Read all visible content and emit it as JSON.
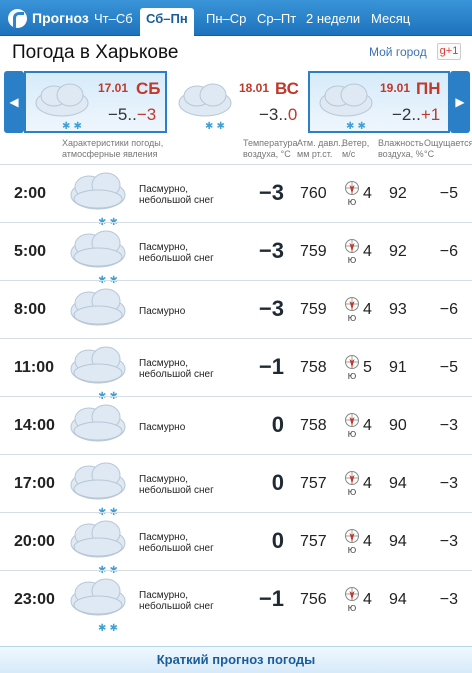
{
  "nav": {
    "brand": "Прогноз",
    "tabs": [
      "Чт–Сб",
      "Сб–Пн",
      "Пн–Ср",
      "Ср–Пт",
      "2 недели",
      "Месяц"
    ],
    "active_tab": "Сб–Пн"
  },
  "header": {
    "title": "Погода в Харькове",
    "my_city": "Мой город",
    "gplus": "g+1"
  },
  "days": [
    {
      "date": "17.01",
      "name": "СБ",
      "temp_min": "−5..",
      "temp_max": "−3",
      "selected": false
    },
    {
      "date": "18.01",
      "name": "ВС",
      "temp_min": "−3..",
      "temp_max": "0",
      "selected": true
    },
    {
      "date": "19.01",
      "name": "ПН",
      "temp_min": "−2..",
      "temp_max": "+1",
      "selected": false
    }
  ],
  "columns": {
    "condition": [
      "Характеристики погоды,",
      "атмосферные явления"
    ],
    "temperature": [
      "Температура",
      "воздуха, °С"
    ],
    "pressure": [
      "Атм. давл.,",
      "мм рт.ст."
    ],
    "wind": [
      "Ветер,",
      "м/с"
    ],
    "humidity": [
      "Влажность",
      "воздуха, %"
    ],
    "feels": [
      "Ощущается,",
      "°С"
    ]
  },
  "rows": [
    {
      "time": "2:00",
      "cond1": "Пасмурно,",
      "cond2": "небольшой снег",
      "snow": true,
      "temp": "−3",
      "pressure": "760",
      "wind_dir": "Ю",
      "wind": "4",
      "humidity": "92",
      "feels": "−5"
    },
    {
      "time": "5:00",
      "cond1": "Пасмурно,",
      "cond2": "небольшой снег",
      "snow": true,
      "temp": "−3",
      "pressure": "759",
      "wind_dir": "Ю",
      "wind": "4",
      "humidity": "92",
      "feels": "−6"
    },
    {
      "time": "8:00",
      "cond1": "Пасмурно",
      "cond2": "",
      "snow": false,
      "temp": "−3",
      "pressure": "759",
      "wind_dir": "Ю",
      "wind": "4",
      "humidity": "93",
      "feels": "−6"
    },
    {
      "time": "11:00",
      "cond1": "Пасмурно,",
      "cond2": "небольшой снег",
      "snow": true,
      "temp": "−1",
      "pressure": "758",
      "wind_dir": "Ю",
      "wind": "5",
      "humidity": "91",
      "feels": "−5"
    },
    {
      "time": "14:00",
      "cond1": "Пасмурно",
      "cond2": "",
      "snow": false,
      "temp": "0",
      "pressure": "758",
      "wind_dir": "Ю",
      "wind": "4",
      "humidity": "90",
      "feels": "−3"
    },
    {
      "time": "17:00",
      "cond1": "Пасмурно,",
      "cond2": "небольшой снег",
      "snow": true,
      "temp": "0",
      "pressure": "757",
      "wind_dir": "Ю",
      "wind": "4",
      "humidity": "94",
      "feels": "−3"
    },
    {
      "time": "20:00",
      "cond1": "Пасмурно,",
      "cond2": "небольшой снег",
      "snow": true,
      "temp": "0",
      "pressure": "757",
      "wind_dir": "Ю",
      "wind": "4",
      "humidity": "94",
      "feels": "−3"
    },
    {
      "time": "23:00",
      "cond1": "Пасмурно,",
      "cond2": "небольшой снег",
      "snow": true,
      "temp": "−1",
      "pressure": "756",
      "wind_dir": "Ю",
      "wind": "4",
      "humidity": "94",
      "feels": "−3"
    }
  ],
  "footer": {
    "link": "Краткий прогноз погоды"
  },
  "colors": {
    "nav": "#2c86cf",
    "accent_red": "#c0392b",
    "link": "#1a5d9b"
  }
}
